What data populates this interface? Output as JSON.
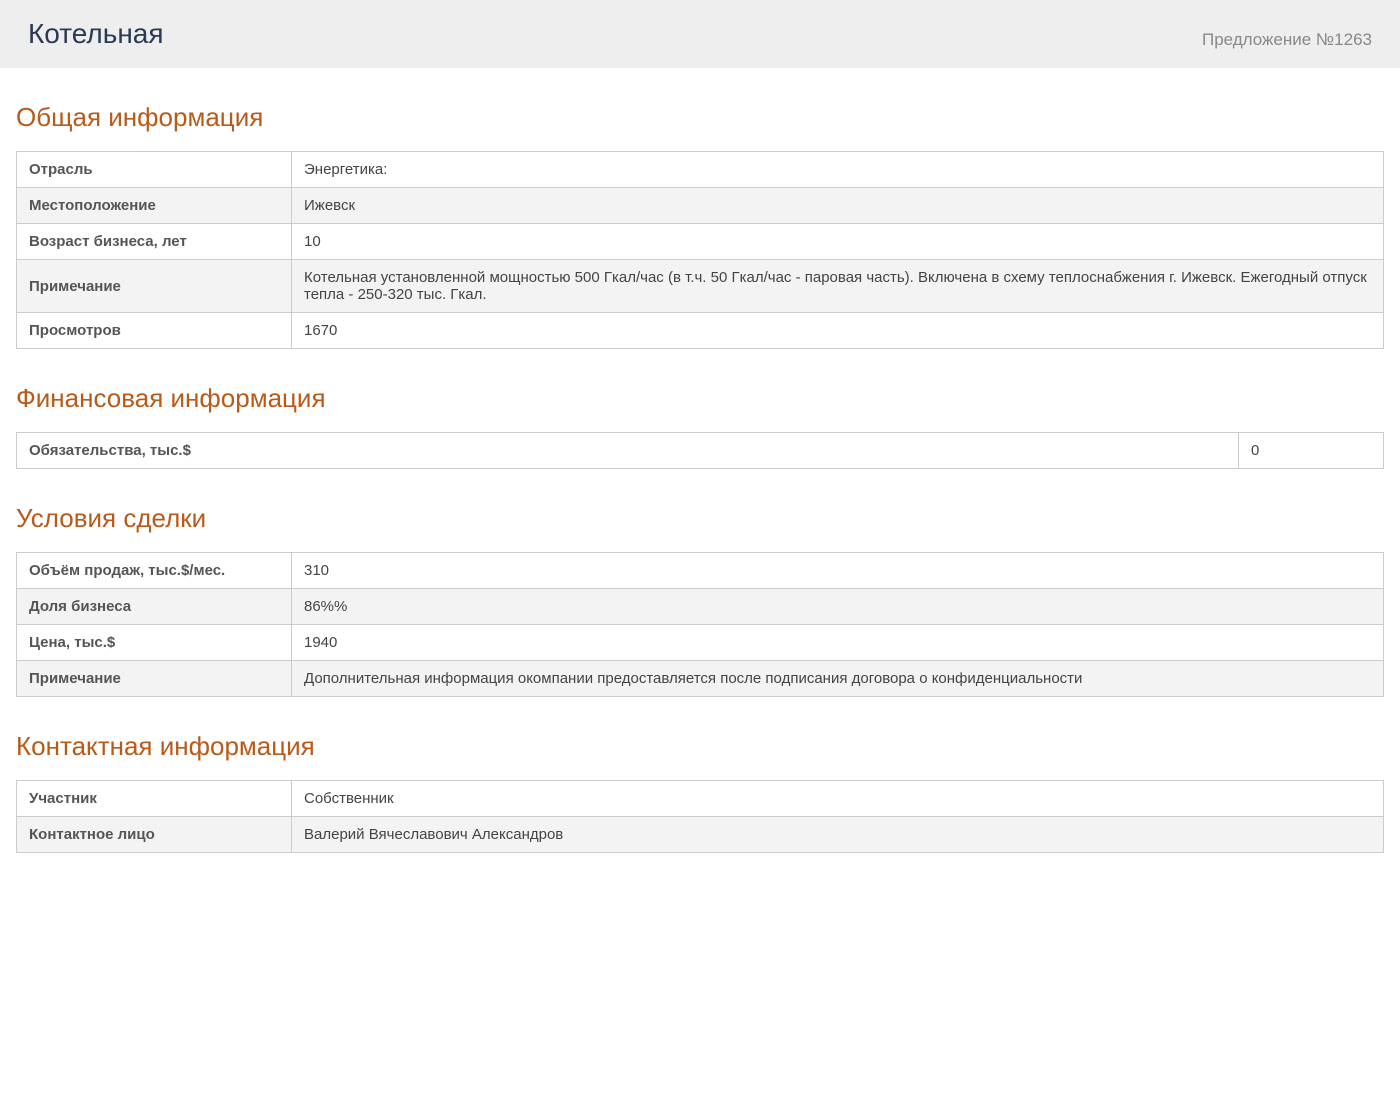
{
  "header": {
    "title": "Котельная",
    "offer_label": "Предложение №1263"
  },
  "sections": {
    "general": {
      "heading": "Общая информация",
      "rows": [
        {
          "label": "Отрасль",
          "value": "Энергетика:"
        },
        {
          "label": "Местоположение",
          "value": "Ижевск"
        },
        {
          "label": "Возраст бизнеса, лет",
          "value": "10"
        },
        {
          "label": "Примечание",
          "value": "Котельная установленной мощностью 500 Гкал/час (в т.ч. 50 Гкал/час - паровая часть). Включена в схему теплоснабжения г. Ижевск. Ежегодный отпуск тепла - 250-320 тыс. Гкал."
        },
        {
          "label": "Просмотров",
          "value": "1670"
        }
      ]
    },
    "financial": {
      "heading": "Финансовая информация",
      "rows": [
        {
          "label": "Обязательства, тыс.$",
          "value": "0"
        }
      ]
    },
    "deal": {
      "heading": "Условия сделки",
      "rows": [
        {
          "label": "Объём продаж, тыс.$/мес.",
          "value": "310"
        },
        {
          "label": "Доля бизнеса",
          "value": "86%%"
        },
        {
          "label": "Цена, тыс.$",
          "value": "1940"
        },
        {
          "label": "Примечание",
          "value": "Дополнительная информация окомпании предоставляется после подписания договора о конфиденциальности"
        }
      ]
    },
    "contact": {
      "heading": "Контактная информация",
      "rows": [
        {
          "label": "Участник",
          "value": "Собственник"
        },
        {
          "label": "Контактное лицо",
          "value": "Валерий Вячеславович Александров"
        }
      ]
    }
  }
}
